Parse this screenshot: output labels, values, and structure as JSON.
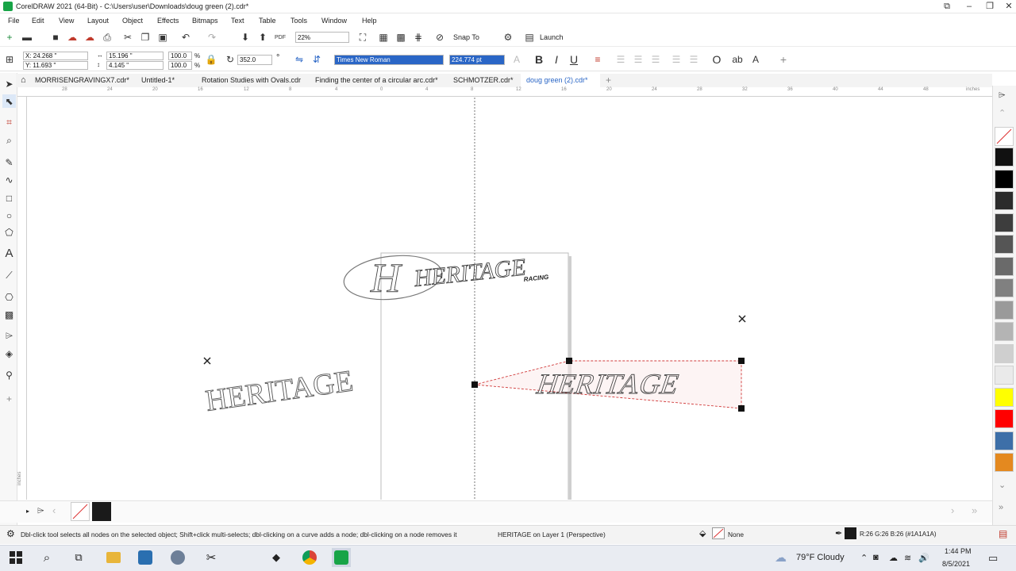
{
  "window": {
    "title": "CorelDRAW 2021 (64-Bit) - C:\\Users\\user\\Downloads\\doug green (2).cdr*"
  },
  "menu": [
    "File",
    "Edit",
    "View",
    "Layout",
    "Object",
    "Effects",
    "Bitmaps",
    "Text",
    "Table",
    "Tools",
    "Window",
    "Help"
  ],
  "standard_toolbar": {
    "zoom": "22%",
    "snap_to": "Snap To",
    "launch": "Launch"
  },
  "property_bar": {
    "x": "X: 24.268 \"",
    "y": "Y: 11.693 \"",
    "width": "15.196 \"",
    "height": "4.145 \"",
    "scale_w": "100.0",
    "scale_h": "100.0",
    "scale_unit": "%",
    "rotation": "352.0",
    "degree": "°",
    "font": "Times New Roman",
    "font_size": "224.774 pt"
  },
  "tabs": [
    {
      "label": "MORRISENGRAVINGX7.cdr*",
      "active": false
    },
    {
      "label": "Untitled-1*",
      "active": false
    },
    {
      "label": "Rotation Studies with Ovals.cdr",
      "active": false
    },
    {
      "label": "Finding the center of a circular arc.cdr*",
      "active": false
    },
    {
      "label": "SCHMOTZER.cdr*",
      "active": false
    },
    {
      "label": "doug green (2).cdr*",
      "active": true
    }
  ],
  "ruler": {
    "units": "inches",
    "h_ticks": [
      "28",
      "24",
      "20",
      "16",
      "12",
      "8",
      "4",
      "0",
      "4",
      "8",
      "12",
      "16",
      "20",
      "24",
      "28",
      "32",
      "36",
      "40",
      "44",
      "48"
    ]
  },
  "artwork": {
    "logo_main": "HERITAGE",
    "logo_sub": "RACING",
    "text_left": "HERITAGE",
    "text_perspective": "HERITAGE"
  },
  "palette_colors": [
    "#111111",
    "#000000",
    "#2b2b2b",
    "#3d3d3d",
    "#555555",
    "#6a6a6a",
    "#808080",
    "#9a9a9a",
    "#b4b4b4",
    "#cfcfcf",
    "#eaeaea",
    "#ffff00",
    "#ff0000",
    "#3d6fa8",
    "#e4891f"
  ],
  "status": {
    "hint": "Dbl-click tool selects all nodes on the selected object; Shift+click multi-selects; dbl-clicking on a curve adds a node; dbl-clicking on a node removes it",
    "object_info": "HERITAGE on Layer 1  (Perspective)",
    "fill": "None",
    "outline_color": "R:26 G:26 B:26 (#1A1A1A)",
    "outline_hex": "#1A1A1A"
  },
  "taskbar": {
    "weather": "79°F  Cloudy",
    "time": "1:44 PM",
    "date": "8/5/2021"
  }
}
